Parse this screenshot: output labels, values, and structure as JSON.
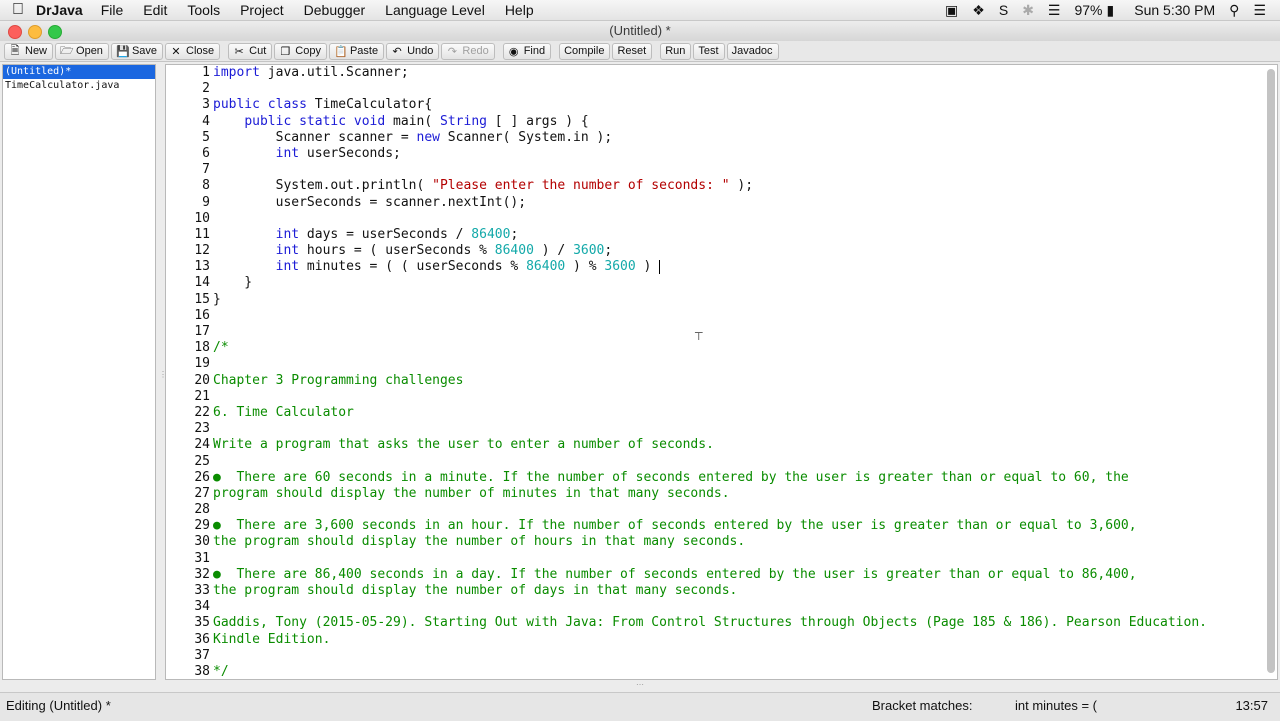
{
  "menubar": {
    "app_name": "DrJava",
    "items": [
      "File",
      "Edit",
      "Tools",
      "Project",
      "Debugger",
      "Language Level",
      "Help"
    ],
    "battery": "97%",
    "clock": "Sun 5:30 PM"
  },
  "window": {
    "title": "(Untitled) *"
  },
  "toolbar": {
    "new": "New",
    "open": "Open",
    "save": "Save",
    "close": "Close",
    "cut": "Cut",
    "copy": "Copy",
    "paste": "Paste",
    "undo": "Undo",
    "redo": "Redo",
    "find": "Find",
    "compile": "Compile",
    "reset": "Reset",
    "run": "Run",
    "test": "Test",
    "javadoc": "Javadoc"
  },
  "files": [
    {
      "name": "(Untitled)*",
      "selected": true
    },
    {
      "name": "TimeCalculator.java",
      "selected": false
    }
  ],
  "code_lines": [
    "import java.util.Scanner;",
    "",
    "public class TimeCalculator{",
    "    public static void main( String [ ] args ) {",
    "        Scanner scanner = new Scanner( System.in );",
    "        int userSeconds;",
    "",
    "        System.out.println( \"Please enter the number of seconds: \" );",
    "        userSeconds = scanner.nextInt();",
    "",
    "        int days = userSeconds / 86400;",
    "        int hours = ( userSeconds % 86400 ) / 3600;",
    "        int minutes = ( ( userSeconds % 86400 ) % 3600 ) ",
    "    }",
    "}",
    "",
    "",
    "/*",
    "",
    "Chapter 3 Programming challenges",
    "",
    "6. Time Calculator",
    "",
    "Write a program that asks the user to enter a number of seconds.",
    "",
    "●  There are 60 seconds in a minute. If the number of seconds entered by the user is greater than or equal to 60, the",
    "program should display the number of minutes in that many seconds.",
    "",
    "●  There are 3,600 seconds in an hour. If the number of seconds entered by the user is greater than or equal to 3,600,",
    "the program should display the number of hours in that many seconds.",
    "",
    "●  There are 86,400 seconds in a day. If the number of seconds entered by the user is greater than or equal to 86,400,",
    "the program should display the number of days in that many seconds.",
    "",
    "Gaddis, Tony (2015-05-29). Starting Out with Java: From Control Structures through Objects (Page 185 & 186). Pearson Education.",
    "Kindle Edition.",
    "",
    "*/"
  ],
  "status": {
    "editing": "Editing (Untitled) *",
    "bracket_label": "Bracket matches:",
    "bracket_value": "int minutes = (",
    "position": "13:57"
  },
  "colors": {
    "keyword": "#1b1bd6",
    "string": "#b30000",
    "number": "#13a9a9",
    "comment": "#0a8c00",
    "selection": "#1b67e0"
  }
}
